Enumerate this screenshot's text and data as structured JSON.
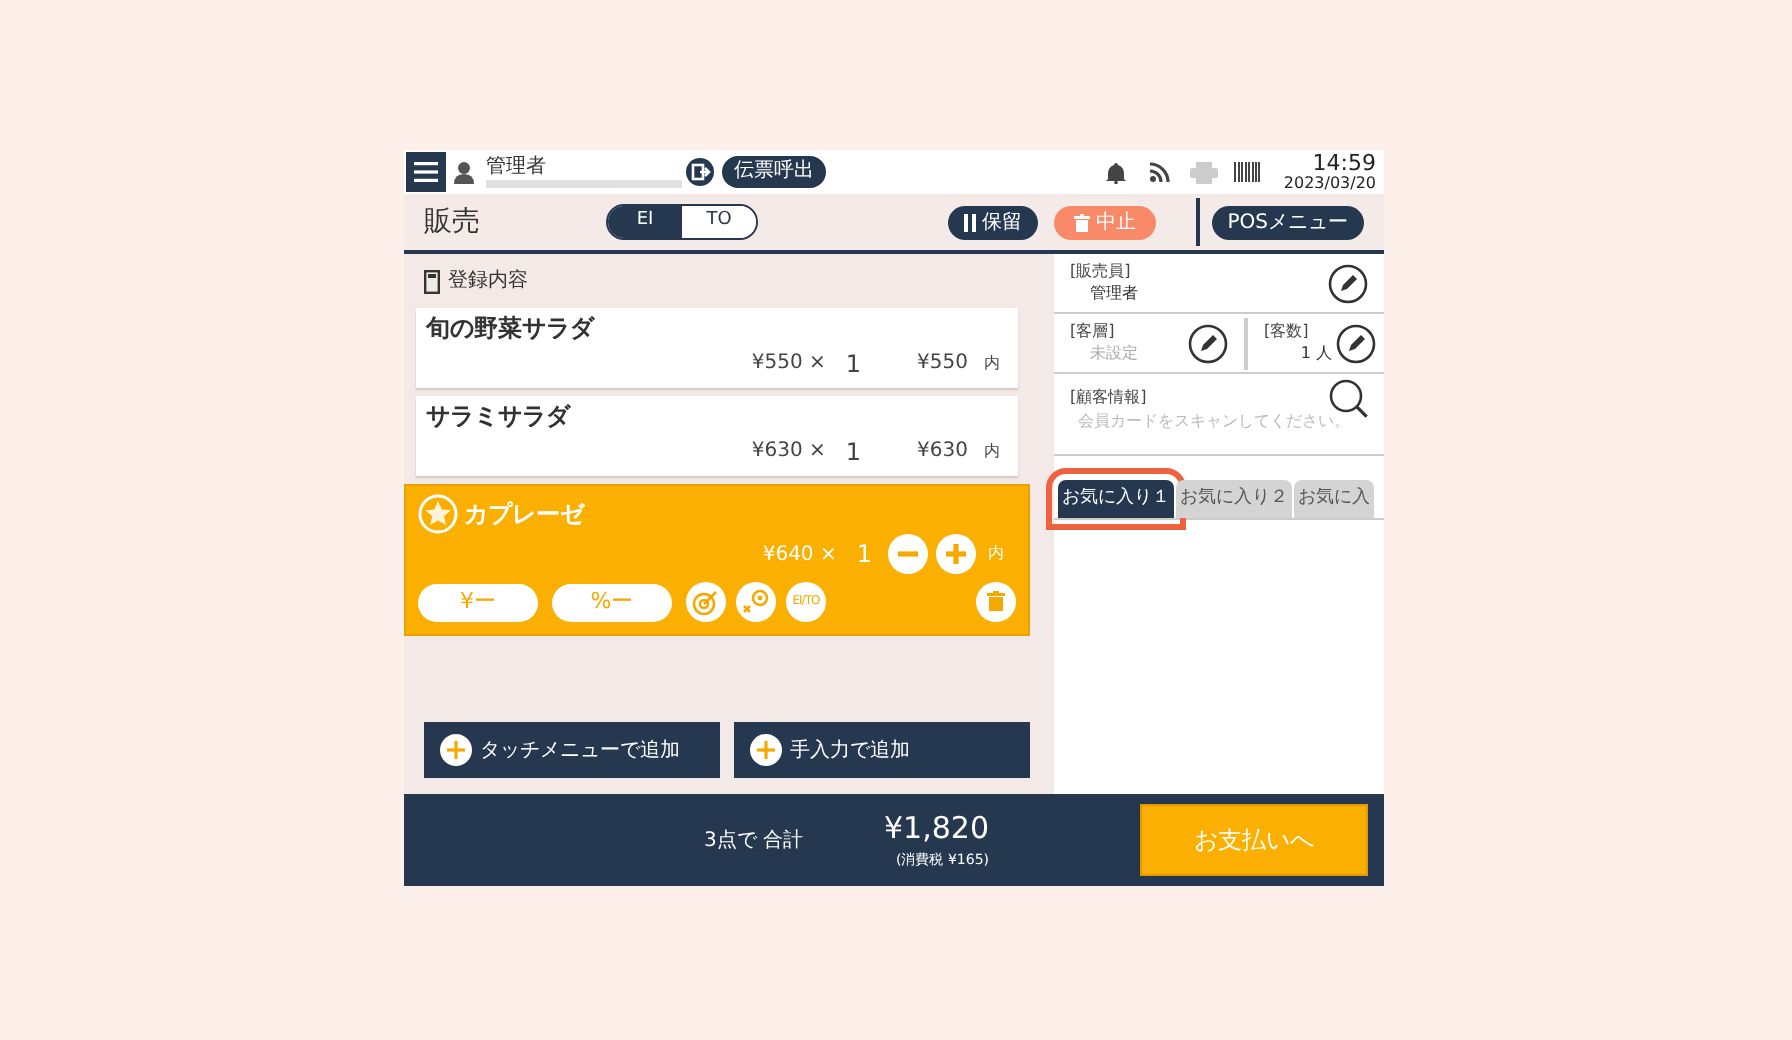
{
  "header": {
    "user": "管理者",
    "recall_button": "伝票呼出",
    "time": "14:59",
    "date": "2023/03/20"
  },
  "toolbar": {
    "title": "販売",
    "modes": [
      {
        "label": "EI",
        "selected": true
      },
      {
        "label": "TO",
        "selected": false
      }
    ],
    "hold_button": "保留",
    "cancel_button": "中止",
    "menu_button": "POSメニュー"
  },
  "order": {
    "heading": "登録内容",
    "items": [
      {
        "name": "旬の野菜サラダ",
        "unit_price": "¥550 ×",
        "qty": "1",
        "amount": "¥550",
        "tax": "内",
        "selected": false
      },
      {
        "name": "サラミサラダ",
        "unit_price": "¥630 ×",
        "qty": "1",
        "amount": "¥630",
        "tax": "内",
        "selected": false
      },
      {
        "name": "カプレーゼ",
        "unit_price": "¥640 ×",
        "qty": "1",
        "tax": "内",
        "selected": true
      }
    ],
    "discount_buttons": [
      "¥ー",
      "%ー"
    ],
    "switch_button": "EI/TO",
    "add_buttons": [
      "タッチメニューで追加",
      "手入力で追加"
    ]
  },
  "info": {
    "staff": {
      "label": "[販売員]",
      "value": "管理者"
    },
    "segment": {
      "label": "[客層]",
      "value": "未設定"
    },
    "guests": {
      "label": "[客数]",
      "value": "1 人"
    },
    "customer": {
      "label": "[顧客情報]",
      "prompt": "会員カードをスキャンしてください。"
    }
  },
  "favorite_tabs": [
    {
      "label": "お気に入り１",
      "selected": true,
      "highlighted": true
    },
    {
      "label": "お気に入り２",
      "selected": false,
      "highlighted": false
    },
    {
      "label": "お気に入",
      "selected": false,
      "highlighted": false
    }
  ],
  "footer": {
    "count": "3点で 合計",
    "total": "¥1,820",
    "tax": "(消費税 ¥165)",
    "pay_button": "お支払いへ"
  }
}
